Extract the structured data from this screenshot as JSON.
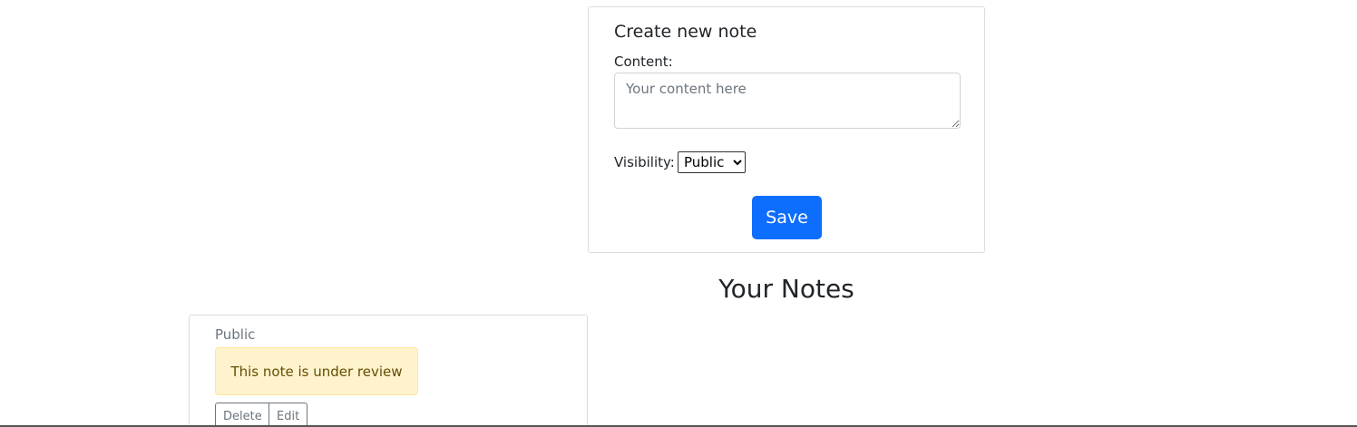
{
  "create_form": {
    "title": "Create new note",
    "content_label": "Content:",
    "content_placeholder": "Your content here",
    "content_value": "",
    "visibility_label": "Visibility:",
    "visibility_selected": "Public",
    "save_label": "Save"
  },
  "notes_section": {
    "heading": "Your Notes"
  },
  "notes": [
    {
      "visibility": "Public",
      "status_message": "This note is under review",
      "delete_label": "Delete",
      "edit_label": "Edit"
    }
  ],
  "colors": {
    "primary": "#0d6efd",
    "warning_bg": "#fff3cd",
    "warning_text": "#664d03",
    "muted": "#6c757d"
  }
}
